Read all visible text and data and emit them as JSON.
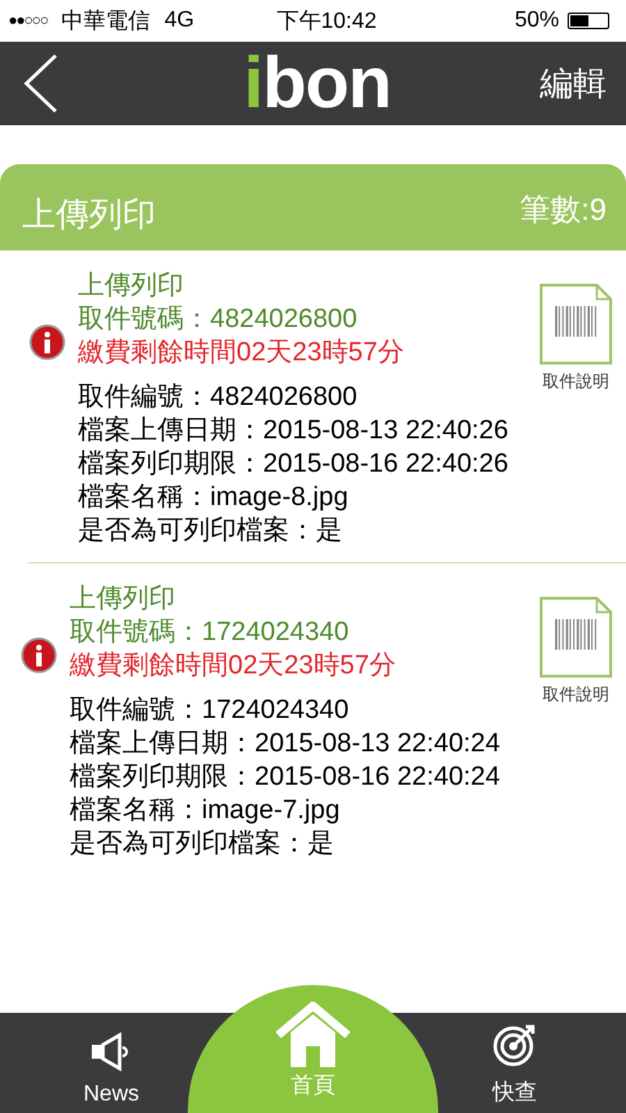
{
  "status_bar": {
    "signal": "●●○○○",
    "carrier": "中華電信",
    "network": "4G",
    "time": "下午10:42",
    "battery": "50%",
    "battery_icon": {
      "level": 0.5
    }
  },
  "nav_bar": {
    "logo": "ibon",
    "action": "編輯"
  },
  "section": {
    "title": "上傳列印",
    "count": "筆數:9"
  },
  "items": [
    {
      "title": "上傳列印",
      "code": "取件號碼：4824026800",
      "remaining": "繳費剩餘時間02天23時57分",
      "help": "取件說明",
      "details": [
        "取件編號：4824026800",
        "檔案上傳日期：2015-08-13 22:40:26",
        "檔案列印期限：2015-08-16 22:40:26",
        "檔案名稱：image-8.jpg",
        "是否為可列印檔案：是"
      ]
    },
    {
      "title": "上傳列印",
      "code": "取件號碼：1724024340",
      "remaining": "繳費剩餘時間02天23時57分",
      "help": "取件說明",
      "details": [
        "取件編號：1724024340",
        "檔案上傳日期：2015-08-13 22:40:24",
        "檔案列印期限：2015-08-16 22:40:24",
        "檔案名稱：image-7.jpg",
        "是否為可列印檔案：是"
      ]
    }
  ],
  "tab_bar": [
    {
      "kind": "news",
      "label": "News",
      "selected": false
    },
    {
      "kind": "home",
      "label": "首頁",
      "selected": true
    },
    {
      "kind": "search",
      "label": "快查",
      "selected": false
    }
  ]
}
